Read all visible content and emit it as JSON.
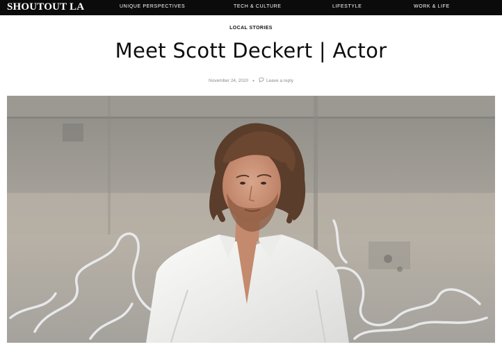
{
  "header": {
    "logo": "SHOUTOUT LA",
    "nav": [
      {
        "label": "UNIQUE PERSPECTIVES"
      },
      {
        "label": "TECH & CULTURE"
      },
      {
        "label": "LIFESTYLE"
      },
      {
        "label": "WORK & LIFE"
      }
    ]
  },
  "article": {
    "category": "LOCAL STORIES",
    "title": "Meet Scott Deckert | Actor",
    "date": "November 24, 2020",
    "separator": "•",
    "reply_label": "Leave a reply",
    "reply_icon": "comment-icon"
  },
  "hero_image": {
    "subject": "portrait-photo"
  },
  "colors": {
    "topbar": "#0b0b0b",
    "wall": "#a9a6a1",
    "shirt": "#f4f4f2"
  }
}
